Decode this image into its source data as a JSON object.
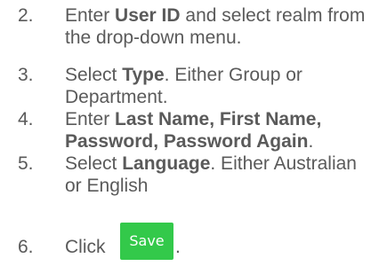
{
  "steps": [
    {
      "number": "2.",
      "parts": [
        "Enter ",
        "User ID",
        " and select realm from the drop-down menu."
      ]
    },
    {
      "number": "3.",
      "parts": [
        "Select ",
        "Type",
        ". Either Group or Department."
      ]
    },
    {
      "number": "4.",
      "parts": [
        "Enter ",
        "Last Name, First Name, Password, Password Again",
        "."
      ]
    },
    {
      "number": "5.",
      "parts": [
        "Select ",
        "Language",
        ". Either Australian or English"
      ]
    },
    {
      "number": "6.",
      "text": "Click",
      "after_button": "."
    }
  ],
  "save_button": {
    "label": "Save",
    "color": "#33c94a"
  }
}
